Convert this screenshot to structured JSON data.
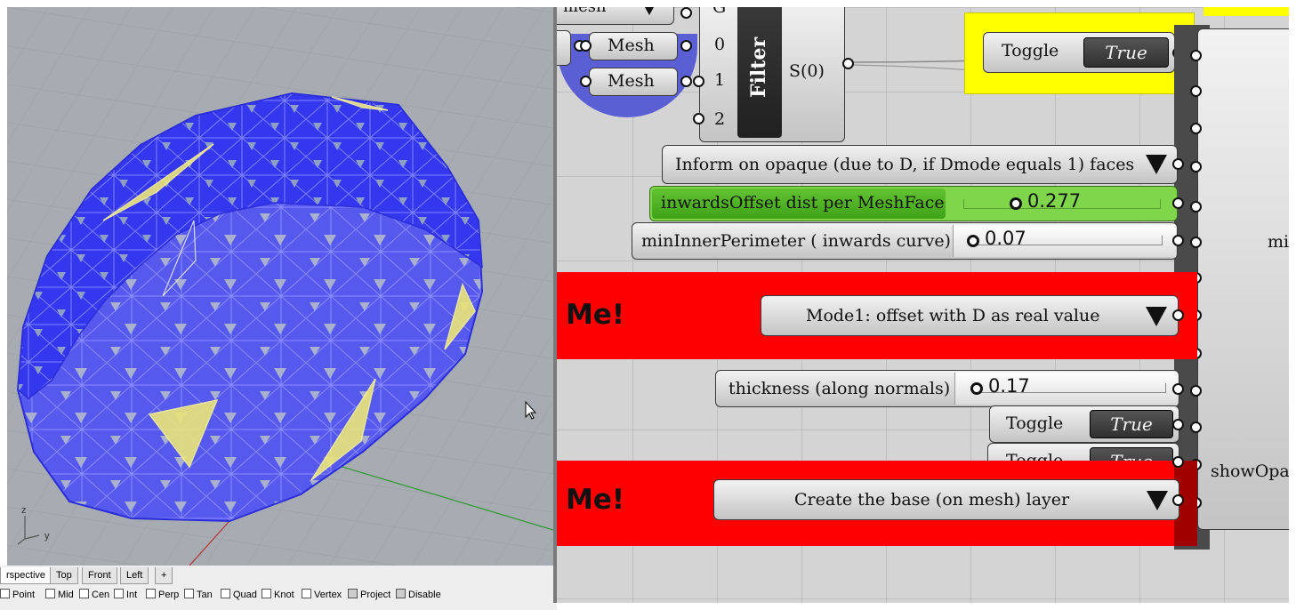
{
  "rhino": {
    "axis_labels": {
      "z": "z",
      "y": "y"
    },
    "tabs": [
      {
        "label": "rspective",
        "active": true
      },
      {
        "label": "Top",
        "active": false
      },
      {
        "label": "Front",
        "active": false
      },
      {
        "label": "Left",
        "active": false
      },
      {
        "label": "+",
        "active": false
      }
    ],
    "osnaps": [
      {
        "label": "Point",
        "checked": false
      },
      {
        "label": "Mid",
        "checked": false
      },
      {
        "label": "Cen",
        "checked": false
      },
      {
        "label": "Int",
        "checked": false
      },
      {
        "label": "Perp",
        "checked": false
      },
      {
        "label": "Tan",
        "checked": false
      },
      {
        "label": "Quad",
        "checked": false
      },
      {
        "label": "Knot",
        "checked": false
      },
      {
        "label": "Vertex",
        "checked": false
      },
      {
        "label": "Project",
        "checked": false,
        "disabled": true
      },
      {
        "label": "Disable",
        "checked": false,
        "disabled": true
      }
    ],
    "colors": {
      "mesh": "#2c2ff0",
      "viewport_bg": "#a6acb1",
      "highlight_face": "#e8e27a"
    }
  },
  "gh": {
    "top_fragment": "mesh",
    "mesh_params": [
      "Mesh",
      "Mesh"
    ],
    "filter": {
      "name": "Filter",
      "inputs": [
        "G",
        "0",
        "1",
        "2"
      ],
      "output": "S(0)"
    },
    "toggle_top": {
      "label": "Toggle",
      "value": "True"
    },
    "value_list_inform": "Inform on opaque (due to D, if Dmode equals 1) faces",
    "slider_inwards": {
      "label": "inwardsOffset dist per MeshFace",
      "value": "0.277"
    },
    "slider_min_inner": {
      "label": "minInnerPerimeter ( inwards curve)",
      "value": "0.07"
    },
    "scribble_1": "Me!",
    "value_list_mode": "Mode1: offset with D as real value",
    "slider_thickness": {
      "label": "thickness (along normals)",
      "value": "0.17"
    },
    "toggle_1": {
      "label": "Toggle",
      "value": "True"
    },
    "toggle_2": {
      "label": "Toggle",
      "value": "True"
    },
    "scribble_2": "Me!",
    "value_list_base": "Create the base (on mesh) layer",
    "big_comp_inputs": [
      "mi",
      "showOpa"
    ],
    "colors": {
      "group_yellow": "#ffff00",
      "group_red": "#ff0000",
      "slider_green": "#7fd64a"
    }
  }
}
